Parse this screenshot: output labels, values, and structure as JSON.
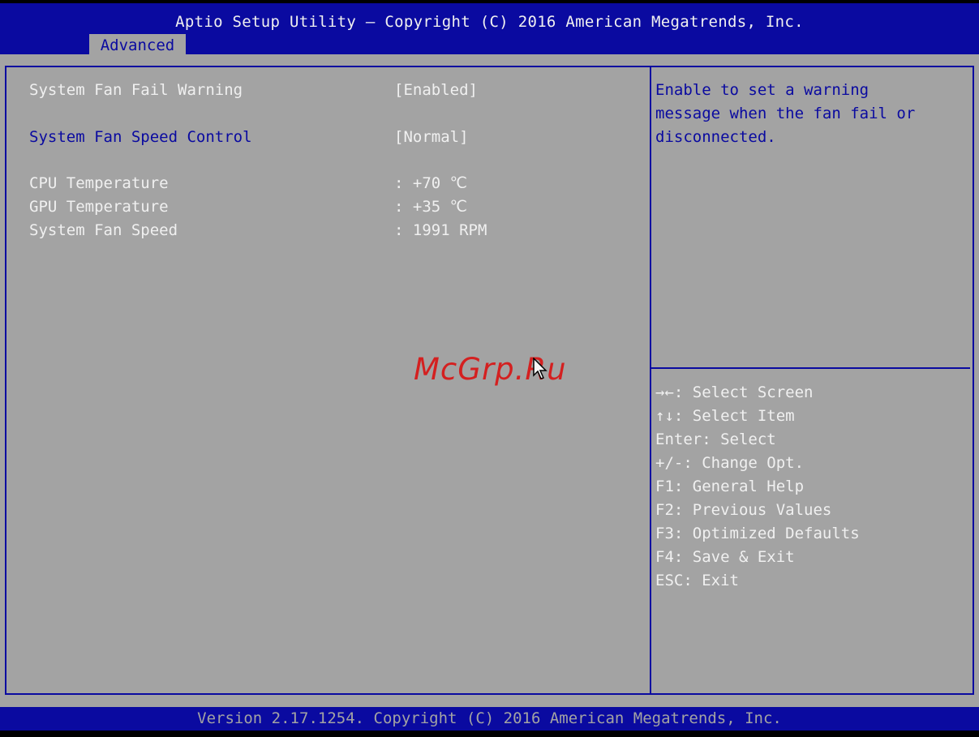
{
  "header": {
    "title": "Aptio Setup Utility – Copyright (C) 2016 American Megatrends, Inc.",
    "active_tab": "Advanced"
  },
  "settings": [
    {
      "label": "System Fan Fail Warning",
      "value": "[Enabled]"
    },
    {
      "label": "System Fan Speed Control",
      "value": "[Normal]"
    }
  ],
  "readouts": [
    {
      "label": "CPU Temperature",
      "value": ": +70 ℃"
    },
    {
      "label": "GPU Temperature",
      "value": ": +35 ℃"
    },
    {
      "label": "System Fan Speed",
      "value": ": 1991 RPM"
    }
  ],
  "help_text": "Enable to set a warning\nmessage when the fan fail or\ndisconnected.",
  "key_help": [
    {
      "key": "→←",
      "desc": ": Select Screen"
    },
    {
      "key": "↑↓",
      "desc": ": Select Item"
    },
    {
      "key": "",
      "desc": "Enter: Select"
    },
    {
      "key": "",
      "desc": "+/-: Change Opt."
    },
    {
      "key": "",
      "desc": "F1: General Help"
    },
    {
      "key": "",
      "desc": "F2: Previous Values"
    },
    {
      "key": "",
      "desc": "F3: Optimized Defaults"
    },
    {
      "key": "",
      "desc": "F4: Save & Exit"
    },
    {
      "key": "",
      "desc": "ESC: Exit"
    }
  ],
  "watermark": "McGrp.Ru",
  "footer": "Version 2.17.1254. Copyright (C) 2016 American Megatrends, Inc.",
  "colors": {
    "bios_blue": "#0a0aa0",
    "bios_gray": "#a3a3a3",
    "text_white": "#f0f0f0",
    "watermark_red": "#d42020"
  },
  "icons": {
    "pointer": "mouse-pointer-icon"
  }
}
